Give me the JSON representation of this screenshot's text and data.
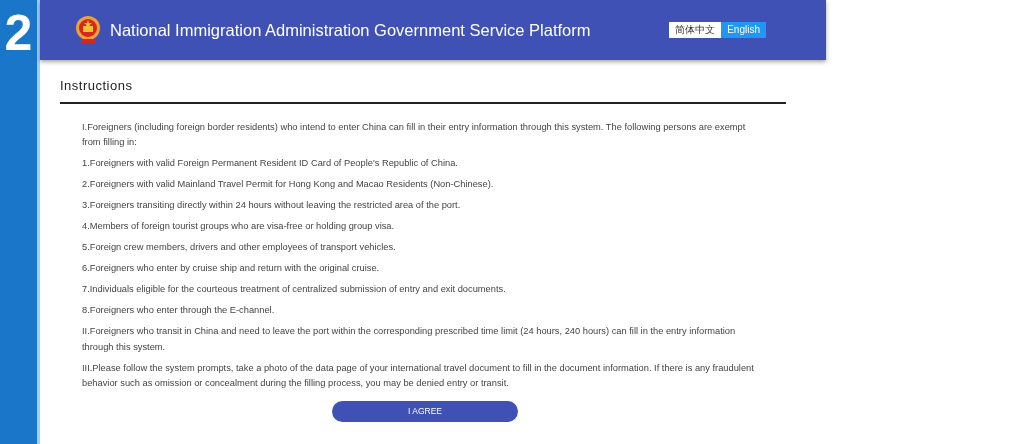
{
  "step_badge": "2",
  "header": {
    "title": "National Immigration Administration Government Service Platform",
    "languages": [
      {
        "label": "简体中文",
        "selected": false
      },
      {
        "label": "English",
        "selected": true
      }
    ]
  },
  "section_title": "Instructions",
  "paragraphs": [
    "I.Foreigners (including foreign border residents) who intend to enter China can fill in their entry information through this system. The following persons are exempt from filling in:",
    "1.Foreigners with valid Foreign Permanent Resident ID Card of People's Republic of China.",
    "2.Foreigners with valid Mainland Travel Permit for Hong Kong and Macao Residents (Non-Chinese).",
    "3.Foreigners transiting directly within 24 hours without leaving the restricted area of the port.",
    "4.Members of foreign tourist groups who are visa-free or holding group visa.",
    "5.Foreign crew members, drivers and other employees of transport vehicles.",
    "6.Foreigners who enter by cruise ship and return with the original cruise.",
    "7.Individuals eligible for the courteous treatment of centralized submission of entry and exit documents.",
    "8.Foreigners who enter through the E-channel.",
    "II.Foreigners who transit in China and need to leave the port within the corresponding prescribed time limit (24 hours, 240 hours) can fill in the entry information through this system.",
    "III.Please follow the system prompts, take a photo of the data page of your international travel document to fill in the document information. If there is any fraudulent behavior such as omission or concealment during the filling process, you may be denied entry or transit."
  ],
  "agree_button": "I AGREE"
}
